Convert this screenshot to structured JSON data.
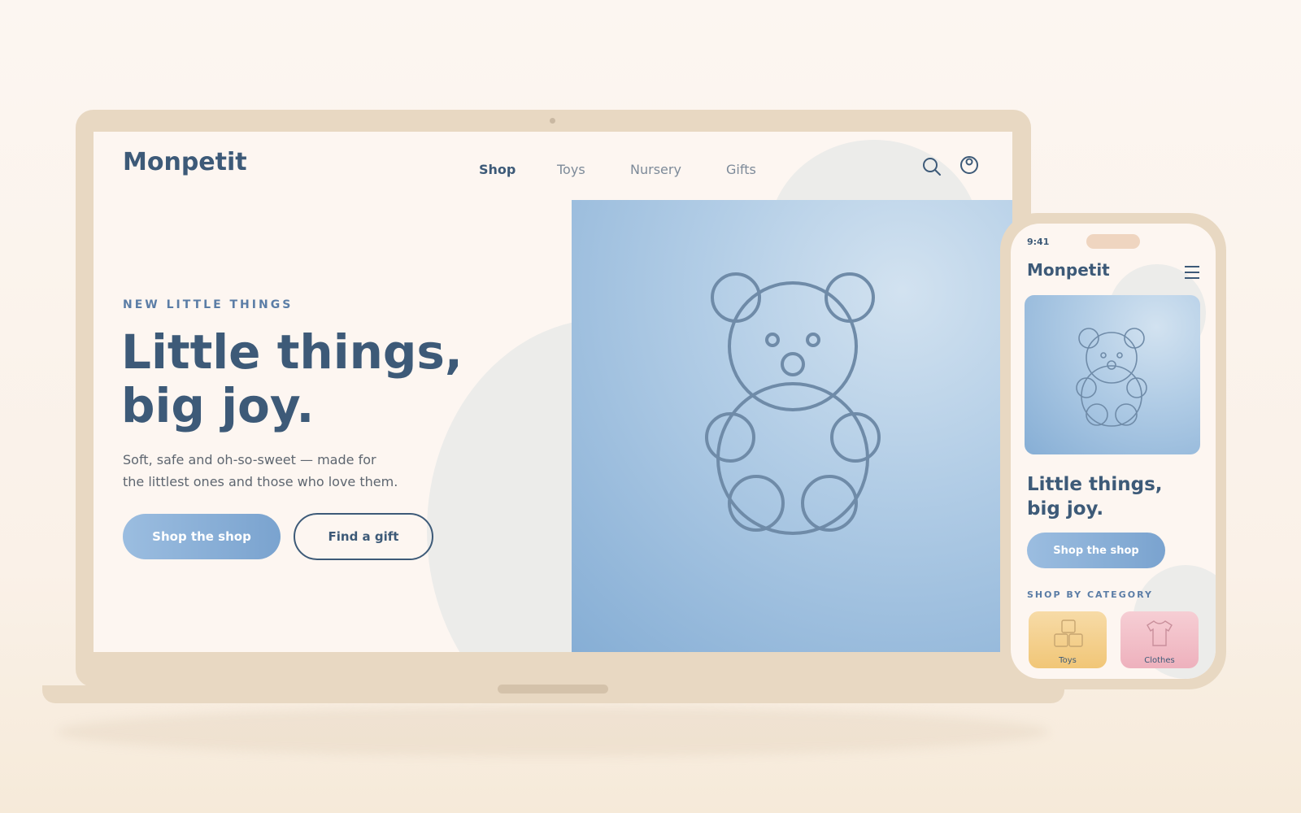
{
  "desktop": {
    "logo": "Monpetit",
    "nav": [
      "Shop",
      "Toys",
      "Nursery",
      "Gifts"
    ],
    "active_nav": "Shop",
    "eyebrow": "NEW LITTLE THINGS",
    "headline_line1": "Little things,",
    "headline_line2": "big joy.",
    "body_line1": "Soft, safe and oh-so-sweet — made for",
    "body_line2": "the littlest ones and those who love them.",
    "primary_cta": "Shop the shop",
    "secondary_cta": "Find a gift",
    "icons": [
      "search-icon",
      "account-icon"
    ]
  },
  "mobile": {
    "time": "9:41",
    "logo": "Monpetit",
    "headline_line1": "Little things,",
    "headline_line2": "big joy.",
    "primary_cta": "Shop the shop",
    "section_title": "SHOP BY CATEGORY",
    "categories": [
      {
        "label": "Toys",
        "icon": "blocks-icon",
        "color": "#f3cf8e"
      },
      {
        "label": "Clothes",
        "icon": "shirt-icon",
        "color": "#f1bcc6"
      }
    ],
    "icons": [
      "menu-icon"
    ]
  },
  "colors": {
    "brand_navy": "#3d5a78",
    "accent_blue": "#7aa3cf",
    "device_frame": "#e8d8c2",
    "background": "#fcf6f1"
  }
}
